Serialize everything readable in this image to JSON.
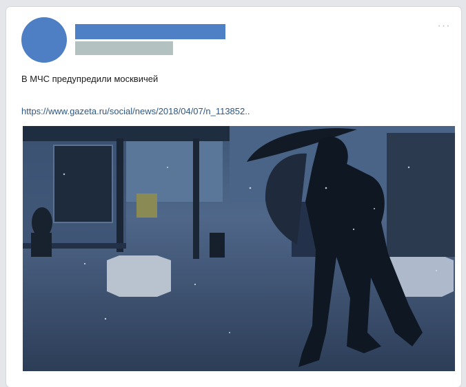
{
  "post": {
    "text": "В МЧС предупредили москвичей",
    "link": "https://www.gazeta.ru/social/news/2018/04/07/n_113852..",
    "more_icon": "more-horizontal-icon"
  },
  "colors": {
    "avatar": "#4e7fc4",
    "name_bar": "#4e80c6",
    "sub_bar": "#b3c2c1",
    "link": "#2a5885"
  }
}
